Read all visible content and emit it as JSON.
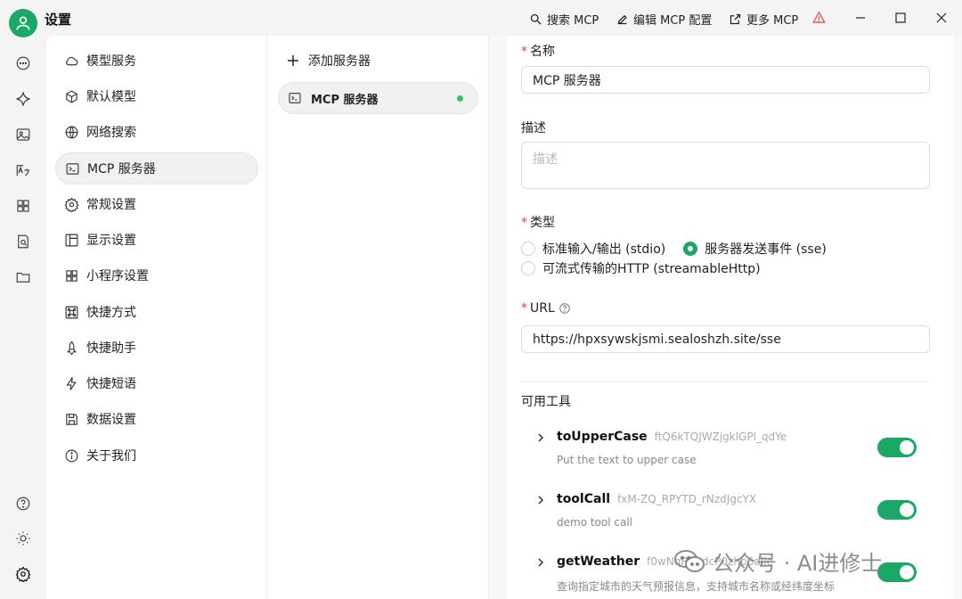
{
  "app": {
    "title": "设置"
  },
  "toolbar": {
    "search_mcp": "搜索 MCP",
    "edit_mcp_config": "编辑 MCP 配置",
    "more_mcp": "更多 MCP"
  },
  "rail": {
    "icons": [
      "chat-icon",
      "sparkle-icon",
      "image-icon",
      "translate-icon",
      "apps-icon",
      "knowledge-icon",
      "folder-icon"
    ],
    "bottom_icons": [
      "help-icon",
      "theme-icon",
      "settings-icon"
    ]
  },
  "nav": {
    "items": [
      {
        "label": "模型服务",
        "icon": "cloud-icon"
      },
      {
        "label": "默认模型",
        "icon": "cube-icon"
      },
      {
        "label": "网络搜索",
        "icon": "globe-icon"
      },
      {
        "label": "MCP 服务器",
        "icon": "terminal-icon",
        "active": true
      },
      {
        "label": "常规设置",
        "icon": "gear-icon"
      },
      {
        "label": "显示设置",
        "icon": "layout-icon"
      },
      {
        "label": "小程序设置",
        "icon": "grid-icon"
      },
      {
        "label": "快捷方式",
        "icon": "command-icon"
      },
      {
        "label": "快捷助手",
        "icon": "rocket-icon"
      },
      {
        "label": "快捷短语",
        "icon": "bolt-icon"
      },
      {
        "label": "数据设置",
        "icon": "save-icon"
      },
      {
        "label": "关于我们",
        "icon": "info-icon"
      }
    ]
  },
  "servers": {
    "add_label": "添加服务器",
    "items": [
      {
        "label": "MCP 服务器",
        "status_color": "#31c36a"
      }
    ]
  },
  "form": {
    "name_label": "名称",
    "name_value": "MCP 服务器",
    "desc_label": "描述",
    "desc_placeholder": "描述",
    "type_label": "类型",
    "type_options": [
      {
        "label": "标准输入/输出 (stdio)",
        "selected": false
      },
      {
        "label": "服务器发送事件 (sse)",
        "selected": true
      },
      {
        "label": "可流式传输的HTTP (streamableHttp)",
        "selected": false
      }
    ],
    "url_label": "URL",
    "url_value": "https://hpxsywskjsmi.sealoshzh.site/sse",
    "tools_label": "可用工具",
    "tools": [
      {
        "name": "toUpperCase",
        "id": "ftQ6kTQJWZjgklGPl_qdYe",
        "desc": "Put the text to upper case",
        "enabled": true
      },
      {
        "name": "toolCall",
        "id": "fxM-ZQ_RPYTD_rNzdJgcYX",
        "desc": "demo tool call",
        "enabled": true
      },
      {
        "name": "getWeather",
        "id": "f0wNqR7hdcP0zhb6dlle",
        "desc": "查询指定城市的天气预报信息，支持城市名称或经纬度坐标",
        "enabled": true
      }
    ]
  },
  "watermark": {
    "text": "公众号 · AI进修士"
  },
  "colors": {
    "accent": "#1ba765",
    "required": "#e54545",
    "warning": "#e54545"
  }
}
